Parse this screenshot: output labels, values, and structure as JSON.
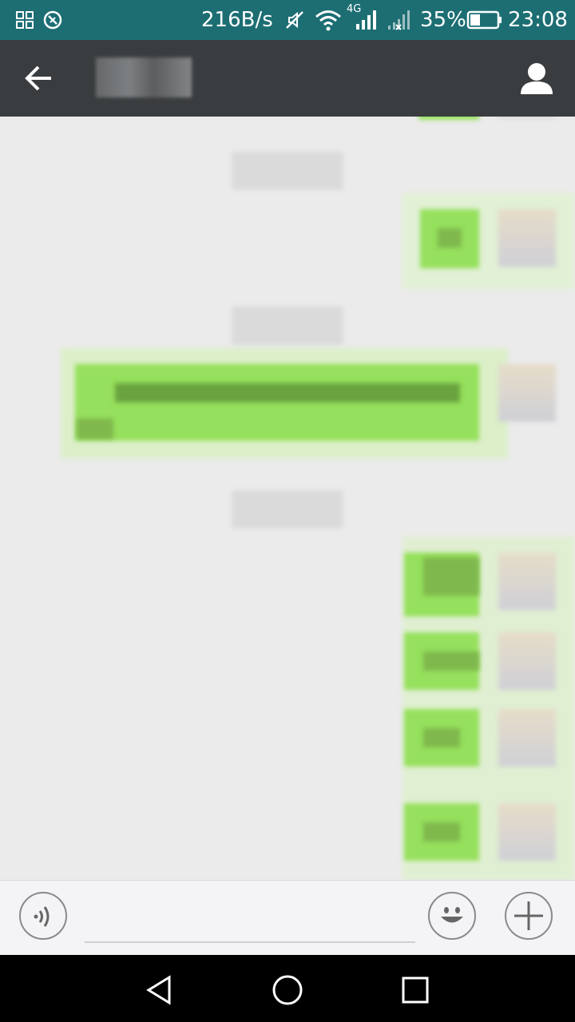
{
  "status_bar": {
    "speed": "216B/s",
    "network": "4G",
    "battery": "35%",
    "time": "23:08",
    "icons": [
      "grid-icon",
      "notification-icon",
      "mute-icon",
      "wifi-icon",
      "signal-icon",
      "signal-x-icon",
      "battery-icon"
    ]
  },
  "header": {
    "back_icon": "arrow-left-icon",
    "profile_icon": "person-icon"
  },
  "input_bar": {
    "voice_icon": "voice-icon",
    "emoji_icon": "smiley-icon",
    "more_icon": "plus-icon"
  },
  "nav_bar": {
    "icons": [
      "back-triangle-icon",
      "home-circle-icon",
      "recents-square-icon"
    ]
  },
  "colors": {
    "status_bar": "#1c6e73",
    "title_bar": "#3a3d3f",
    "chat_bg": "#ebebeb",
    "sent_bubble": "#95e05c"
  }
}
